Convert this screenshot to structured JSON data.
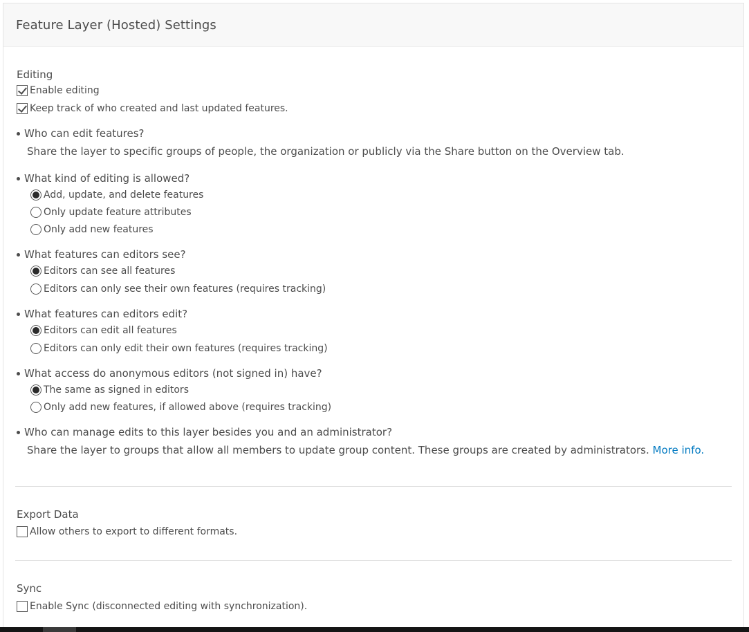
{
  "header": {
    "title": "Feature Layer (Hosted) Settings"
  },
  "editing": {
    "title": "Editing",
    "enable_editing": {
      "label": "Enable editing",
      "checked": true
    },
    "track_editors": {
      "label": "Keep track of who created and last updated features.",
      "checked": true
    },
    "who_can_edit": {
      "question": "Who can edit features?",
      "info": "Share the layer to specific groups of people, the organization or publicly via the Share button on the Overview tab."
    },
    "kind_of_editing": {
      "question": "What kind of editing is allowed?",
      "options": [
        {
          "label": "Add, update, and delete features",
          "selected": true
        },
        {
          "label": "Only update feature attributes",
          "selected": false
        },
        {
          "label": "Only add new features",
          "selected": false
        }
      ]
    },
    "editors_see": {
      "question": "What features can editors see?",
      "options": [
        {
          "label": "Editors can see all features",
          "selected": true
        },
        {
          "label": "Editors can only see their own features (requires tracking)",
          "selected": false
        }
      ]
    },
    "editors_edit": {
      "question": "What features can editors edit?",
      "options": [
        {
          "label": "Editors can edit all features",
          "selected": true
        },
        {
          "label": "Editors can only edit their own features (requires tracking)",
          "selected": false
        }
      ]
    },
    "anonymous_access": {
      "question": "What access do anonymous editors (not signed in) have?",
      "options": [
        {
          "label": "The same as signed in editors",
          "selected": true
        },
        {
          "label": "Only add new features, if allowed above (requires tracking)",
          "selected": false
        }
      ]
    },
    "manage_edits": {
      "question": "Who can manage edits to this layer besides you and an administrator?",
      "info": "Share the layer to groups that allow all members to update group content. These groups are created by administrators.",
      "link": "More info."
    }
  },
  "export_data": {
    "title": "Export Data",
    "allow_export": {
      "label": "Allow others to export to different formats.",
      "checked": false
    }
  },
  "sync": {
    "title": "Sync",
    "enable_sync": {
      "label": "Enable Sync (disconnected editing with synchronization).",
      "checked": false
    }
  },
  "colors": {
    "text": "#4c4c4c",
    "link": "#0079c1",
    "header_bg": "#f8f8f8",
    "divider": "#e0e0e0"
  }
}
